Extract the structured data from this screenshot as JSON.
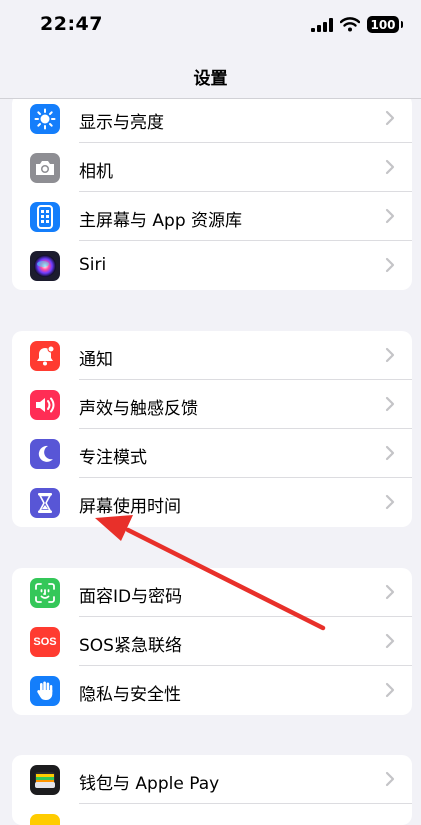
{
  "status_bar": {
    "time": "22:47",
    "battery": "100"
  },
  "nav": {
    "title": "设置"
  },
  "groups": [
    {
      "items": [
        {
          "label": "显示与亮度",
          "icon": "sun-icon",
          "color": "#147efb"
        },
        {
          "label": "相机",
          "icon": "camera-icon",
          "color": "#8e8e93"
        },
        {
          "label": "主屏幕与 App 资源库",
          "icon": "home-screen-icon",
          "color": "#147efb"
        },
        {
          "label": "Siri",
          "icon": "siri-icon",
          "color": "#1c1c2e"
        }
      ]
    },
    {
      "items": [
        {
          "label": "通知",
          "icon": "bell-icon",
          "color": "#ff3b30"
        },
        {
          "label": "声效与触感反馈",
          "icon": "speaker-icon",
          "color": "#ff2d55"
        },
        {
          "label": "专注模式",
          "icon": "moon-icon",
          "color": "#5856d6"
        },
        {
          "label": "屏幕使用时间",
          "icon": "hourglass-icon",
          "color": "#5856d6"
        }
      ]
    },
    {
      "items": [
        {
          "label": "面容ID与密码",
          "icon": "face-id-icon",
          "color": "#34c759"
        },
        {
          "label": "SOS紧急联络",
          "icon": "sos-icon",
          "color": "#ff3b30",
          "badge": "SOS"
        },
        {
          "label": "隐私与安全性",
          "icon": "hand-icon",
          "color": "#147efb"
        }
      ]
    },
    {
      "items": [
        {
          "label": "钱包与 Apple Pay",
          "icon": "wallet-icon",
          "color": "#1c1c1e"
        }
      ]
    }
  ],
  "annotation": {
    "type": "red-arrow",
    "color": "#e8302a",
    "points_to": "屏幕使用时间"
  }
}
